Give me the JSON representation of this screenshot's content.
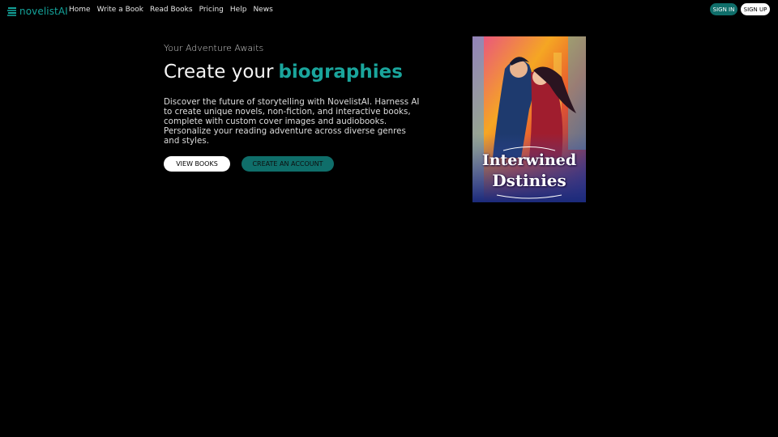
{
  "brand": {
    "name": "novelistAI",
    "color": "#14a39a",
    "icon": "book-stack-icon"
  },
  "nav": {
    "items": [
      {
        "label": "Home"
      },
      {
        "label": "Write a Book"
      },
      {
        "label": "Read Books"
      },
      {
        "label": "Pricing"
      },
      {
        "label": "Help"
      },
      {
        "label": "News"
      }
    ],
    "sign_in": "SIGN IN",
    "sign_up": "SIGN UP"
  },
  "hero": {
    "eyebrow": "Your Adventure Awaits",
    "headline_prefix": "Create your",
    "headline_accent": "biographies",
    "description": "Discover the future of storytelling with NovelistAI. Harness AI to create unique novels, non-fiction, and interactive books, complete with custom cover images and audiobooks. Personalize your reading adventure across diverse genres and styles.",
    "view_books": "VIEW BOOKS",
    "create_account": "CREATE AN ACCOUNT"
  },
  "cover": {
    "title_line1": "Interwined",
    "title_line2": "Dstinies"
  },
  "colors": {
    "accent": "#1aa59c",
    "button_dark": "#0f6e6a",
    "background": "#000000"
  }
}
